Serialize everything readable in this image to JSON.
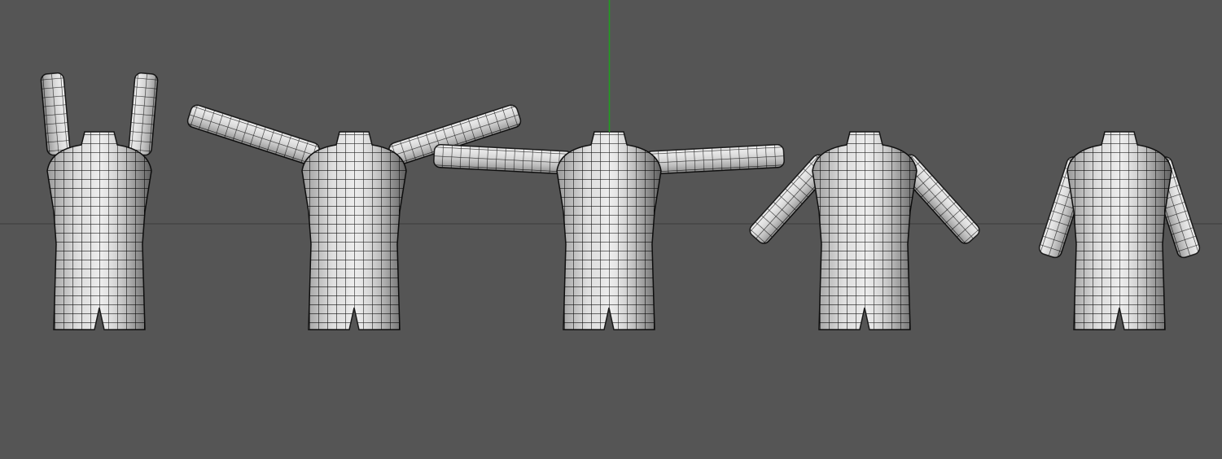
{
  "viewport": {
    "background_color": "#555555",
    "y_axis_color": "#1fa01f",
    "horizon_color": "#3a3a3a",
    "mesh_face_color": "#ececec",
    "mesh_edge_color": "#111111",
    "model_count": 5
  }
}
